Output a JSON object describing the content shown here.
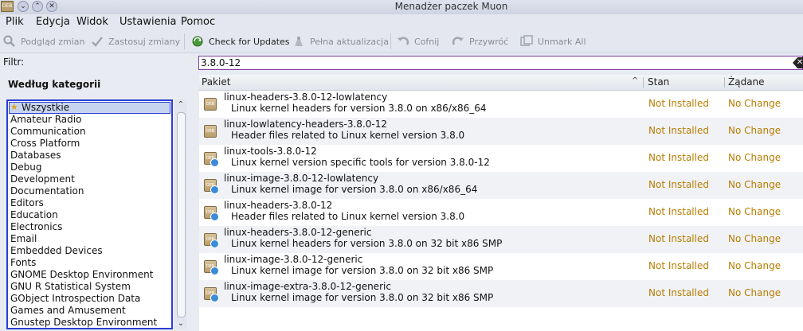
{
  "window": {
    "title": "Menadżer paczek Muon"
  },
  "menubar": [
    "Plik",
    "Edycja",
    "Widok",
    "Ustawienia",
    "Pomoc"
  ],
  "toolbar": {
    "preview": "Podgląd zmian",
    "apply": "Zastosuj zmiany",
    "check_updates": "Check for Updates",
    "full_upgrade": "Pełna aktualizacja",
    "undo": "Cofnij",
    "redo": "Przywróć",
    "unmark_all": "Unmark All"
  },
  "filter": {
    "label": "Filtr:",
    "value": "3.8.0-12"
  },
  "categories": {
    "heading": "Według kategorii",
    "items": [
      "Wszystkie",
      "Amateur Radio",
      "Communication",
      "Cross Platform",
      "Databases",
      "Debug",
      "Development",
      "Documentation",
      "Editors",
      "Education",
      "Electronics",
      "Email",
      "Embedded Devices",
      "Fonts",
      "GNOME Desktop Environment",
      "GNU R Statistical System",
      "GObject Introspection Data",
      "Games and Amusement",
      "Gnustep Desktop Environment"
    ]
  },
  "table": {
    "columns": {
      "package": "Pakiet",
      "state": "Stan",
      "requested": "Żądane"
    },
    "rows": [
      {
        "name": "linux-headers-3.8.0-12-lowlatency",
        "desc": "Linux kernel headers for version 3.8.0 on x86/x86_64",
        "state": "Not Installed",
        "requested": "No Change"
      },
      {
        "name": "linux-lowlatency-headers-3.8.0-12",
        "desc": "Header files related to Linux kernel version 3.8.0",
        "state": "Not Installed",
        "requested": "No Change"
      },
      {
        "name": "linux-tools-3.8.0-12",
        "desc": "Linux kernel version specific tools for version 3.8.0-12",
        "state": "Not Installed",
        "requested": "No Change"
      },
      {
        "name": "linux-image-3.8.0-12-lowlatency",
        "desc": "Linux kernel image for version 3.8.0 on x86/x86_64",
        "state": "Not Installed",
        "requested": "No Change"
      },
      {
        "name": "linux-headers-3.8.0-12",
        "desc": "Header files related to Linux kernel version 3.8.0",
        "state": "Not Installed",
        "requested": "No Change"
      },
      {
        "name": "linux-headers-3.8.0-12-generic",
        "desc": "Linux kernel headers for version 3.8.0 on 32 bit x86 SMP",
        "state": "Not Installed",
        "requested": "No Change"
      },
      {
        "name": "linux-image-3.8.0-12-generic",
        "desc": "Linux kernel image for version 3.8.0 on 32 bit x86 SMP",
        "state": "Not Installed",
        "requested": "No Change"
      },
      {
        "name": "linux-image-extra-3.8.0-12-generic",
        "desc": "Linux kernel image for version 3.8.0 on 32 bit x86 SMP",
        "state": "Not Installed",
        "requested": "No Change"
      }
    ]
  },
  "colors": {
    "accent": "#2a3fd4",
    "search_border": "#7b3c9c",
    "status": "#b87d00"
  }
}
